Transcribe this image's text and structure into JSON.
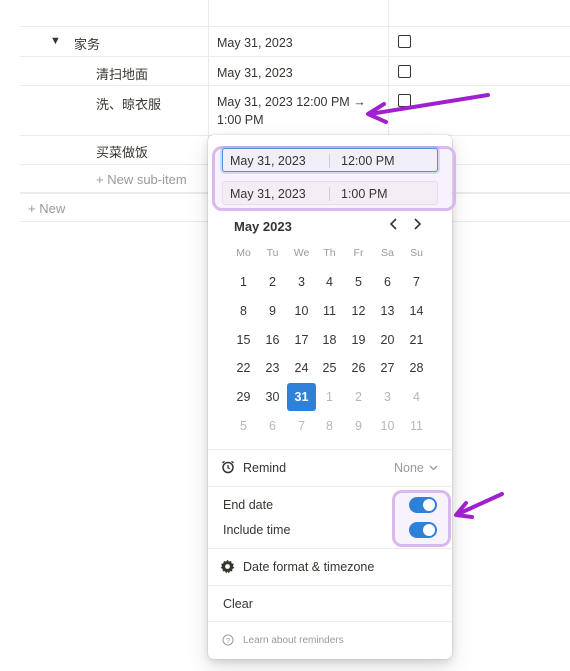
{
  "table": {
    "rows": [
      {
        "title": "家务",
        "date": "May 31, 2023",
        "toggle": "▼"
      },
      {
        "title": "清扫地面",
        "date": "May 31, 2023"
      },
      {
        "title": "洗、晾衣服",
        "date_line1": "May 31, 2023 12:00 PM →",
        "date_line2": "1:00 PM"
      },
      {
        "title": "买菜做饭"
      }
    ],
    "new_sub_item": "+ New sub-item",
    "new": "+ New"
  },
  "popup": {
    "start": {
      "date": "May 31, 2023",
      "time": "12:00 PM"
    },
    "end": {
      "date": "May 31, 2023",
      "time": "1:00 PM"
    },
    "calendar": {
      "month_label": "May 2023",
      "prev": "‹",
      "next": "›",
      "weekdays": [
        "Mo",
        "Tu",
        "We",
        "Th",
        "Fr",
        "Sa",
        "Su"
      ],
      "weeks": [
        [
          {
            "d": "1"
          },
          {
            "d": "2"
          },
          {
            "d": "3"
          },
          {
            "d": "4"
          },
          {
            "d": "5"
          },
          {
            "d": "6"
          },
          {
            "d": "7"
          }
        ],
        [
          {
            "d": "8"
          },
          {
            "d": "9"
          },
          {
            "d": "10"
          },
          {
            "d": "11"
          },
          {
            "d": "12"
          },
          {
            "d": "13"
          },
          {
            "d": "14"
          }
        ],
        [
          {
            "d": "15"
          },
          {
            "d": "16"
          },
          {
            "d": "17"
          },
          {
            "d": "18"
          },
          {
            "d": "19"
          },
          {
            "d": "20"
          },
          {
            "d": "21"
          }
        ],
        [
          {
            "d": "22"
          },
          {
            "d": "23"
          },
          {
            "d": "24"
          },
          {
            "d": "25"
          },
          {
            "d": "26"
          },
          {
            "d": "27"
          },
          {
            "d": "28"
          }
        ],
        [
          {
            "d": "29"
          },
          {
            "d": "30"
          },
          {
            "d": "31",
            "selected": true
          },
          {
            "d": "1",
            "other": true
          },
          {
            "d": "2",
            "other": true
          },
          {
            "d": "3",
            "other": true
          },
          {
            "d": "4",
            "other": true
          }
        ],
        [
          {
            "d": "5",
            "other": true
          },
          {
            "d": "6",
            "other": true
          },
          {
            "d": "7",
            "other": true
          },
          {
            "d": "8",
            "other": true
          },
          {
            "d": "9",
            "other": true
          },
          {
            "d": "10",
            "other": true
          },
          {
            "d": "11",
            "other": true
          }
        ]
      ]
    },
    "remind_label": "Remind",
    "remind_value": "None",
    "end_date_label": "End date",
    "end_date_on": true,
    "include_time_label": "Include time",
    "include_time_on": true,
    "date_format_label": "Date format & timezone",
    "clear_label": "Clear",
    "learn_label": "Learn about reminders"
  },
  "colors": {
    "accent": "#2f80d8",
    "annotation": "#a020d0",
    "highlight": "#d9b8ee"
  },
  "icons": [
    "alarm-clock-icon",
    "gear-icon",
    "help-circle-icon",
    "chevron-down-icon",
    "chevron-left-icon",
    "chevron-right-icon",
    "annotation-arrow"
  ]
}
